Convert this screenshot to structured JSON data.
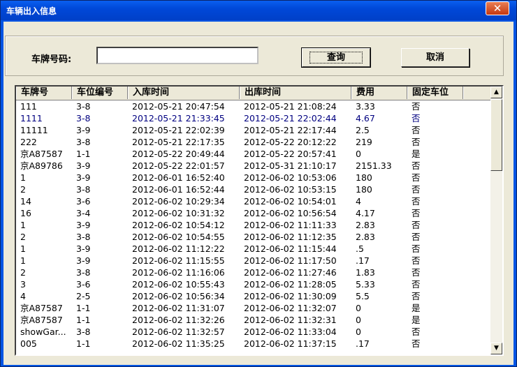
{
  "window": {
    "title": "车辆出入信息",
    "close_glyph": "✕"
  },
  "search": {
    "label": "车牌号码:",
    "value": "",
    "query_button": "查询",
    "cancel_button": "取消"
  },
  "table": {
    "headers": [
      "车牌号",
      "车位编号",
      "入库时间",
      "出库时间",
      "费用",
      "固定车位"
    ],
    "selected_row": 1,
    "rows": [
      [
        "111",
        "3-8",
        "2012-05-21  20:47:54",
        "2012-05-21  21:08:24",
        "3.33",
        "否"
      ],
      [
        "1111",
        "3-8",
        "2012-05-21  21:33:45",
        "2012-05-21  22:02:44",
        "4.67",
        "否"
      ],
      [
        "11111",
        "3-9",
        "2012-05-21  22:02:39",
        "2012-05-21  22:17:44",
        "2.5",
        "否"
      ],
      [
        "222",
        "3-8",
        "2012-05-21  22:17:35",
        "2012-05-22  20:12:22",
        "219",
        "否"
      ],
      [
        "京A87587",
        "1-1",
        "2012-05-22  20:49:44",
        "2012-05-22  20:57:41",
        "0",
        "是"
      ],
      [
        "京A89786",
        "3-9",
        "2012-05-22  22:01:57",
        "2012-05-31  21:10:17",
        "2151.33",
        "否"
      ],
      [
        "1",
        "3-9",
        "2012-06-01  16:52:40",
        "2012-06-02  10:53:06",
        "180",
        "否"
      ],
      [
        "2",
        "3-8",
        "2012-06-01  16:52:44",
        "2012-06-02  10:53:15",
        "180",
        "否"
      ],
      [
        "14",
        "3-6",
        "2012-06-02  10:29:34",
        "2012-06-02  10:54:01",
        "4",
        "否"
      ],
      [
        "16",
        "3-4",
        "2012-06-02  10:31:32",
        "2012-06-02  10:56:54",
        "4.17",
        "否"
      ],
      [
        "1",
        "3-9",
        "2012-06-02  10:54:12",
        "2012-06-02  11:11:33",
        "2.83",
        "否"
      ],
      [
        "2",
        "3-8",
        "2012-06-02  10:54:55",
        "2012-06-02  11:12:35",
        "2.83",
        "否"
      ],
      [
        "1",
        "3-9",
        "2012-06-02  11:12:22",
        "2012-06-02  11:15:44",
        ".5",
        "否"
      ],
      [
        "1",
        "3-9",
        "2012-06-02  11:15:55",
        "2012-06-02  11:17:50",
        ".17",
        "否"
      ],
      [
        "2",
        "3-8",
        "2012-06-02  11:16:06",
        "2012-06-02  11:27:46",
        "1.83",
        "否"
      ],
      [
        "3",
        "3-6",
        "2012-06-02  10:55:43",
        "2012-06-02  11:28:05",
        "5.33",
        "否"
      ],
      [
        "4",
        "2-5",
        "2012-06-02  10:56:34",
        "2012-06-02  11:30:09",
        "5.5",
        "否"
      ],
      [
        "京A87587",
        "1-1",
        "2012-06-02  11:31:07",
        "2012-06-02  11:32:07",
        "0",
        "是"
      ],
      [
        "京A87587",
        "1-1",
        "2012-06-02  11:32:26",
        "2012-06-02  11:32:31",
        "0",
        "是"
      ],
      [
        "showGar...",
        "3-8",
        "2012-06-02  11:32:57",
        "2012-06-02  11:33:04",
        "0",
        "否"
      ],
      [
        "005",
        "1-1",
        "2012-06-02  11:35:25",
        "2012-06-02  11:37:15",
        ".17",
        "否"
      ]
    ]
  },
  "scrollbar": {
    "up_glyph": "▲",
    "down_glyph": "▼"
  }
}
